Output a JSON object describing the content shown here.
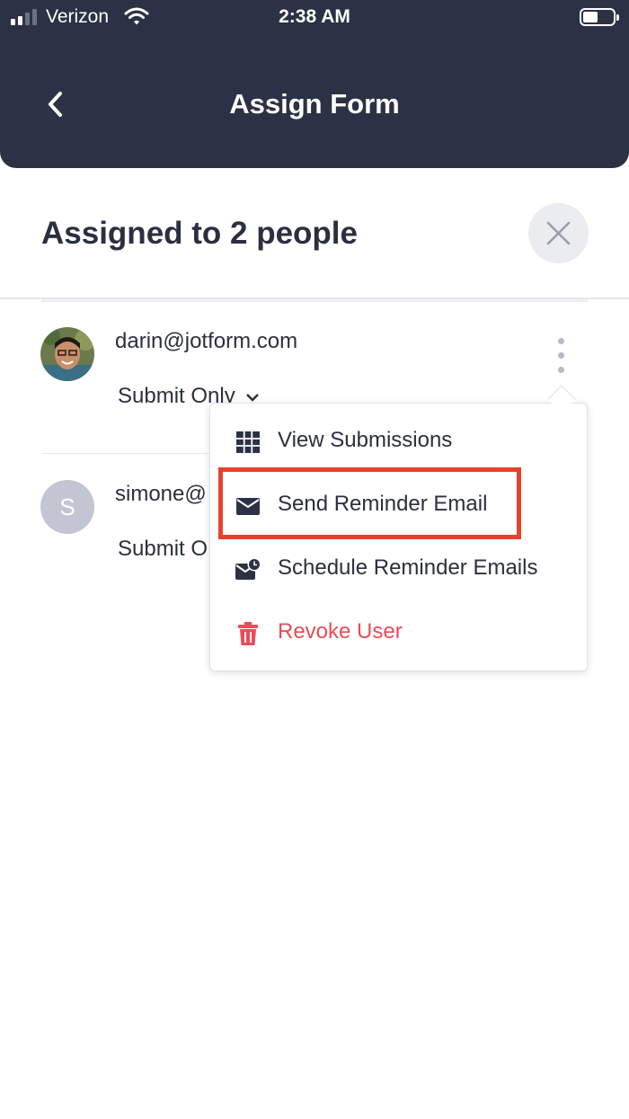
{
  "status_bar": {
    "carrier": "Verizon",
    "time": "2:38 AM"
  },
  "header": {
    "title": "Assign Form"
  },
  "panel": {
    "title": "Assigned to 2 people"
  },
  "assignees": [
    {
      "email": "darin@jotform.com",
      "permission": "Submit Only"
    },
    {
      "initial": "S",
      "email": "simone@",
      "permission": "Submit O"
    }
  ],
  "menu": {
    "items": [
      {
        "label": "View Submissions",
        "icon": "grid-icon"
      },
      {
        "label": "Send Reminder Email",
        "icon": "envelope-icon",
        "highlighted": true
      },
      {
        "label": "Schedule Reminder Emails",
        "icon": "envelope-clock-icon"
      },
      {
        "label": "Revoke User",
        "icon": "trash-icon",
        "danger": true
      }
    ]
  },
  "colors": {
    "header_bg": "#2c3145",
    "text_primary": "#2b2f40",
    "danger": "#e94c57",
    "highlight": "#e8412e",
    "avatar_placeholder": "#c3c5d3"
  }
}
